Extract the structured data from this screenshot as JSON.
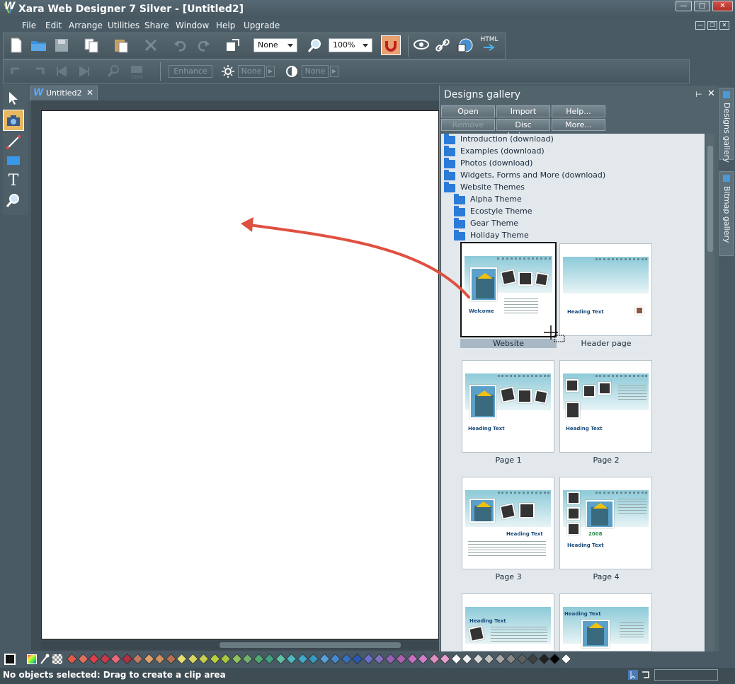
{
  "window": {
    "title": "Xara Web Designer 7 Silver - [Untitled2]"
  },
  "menu": {
    "items": [
      "File",
      "Edit",
      "Arrange",
      "Utilities",
      "Share",
      "Window",
      "Help",
      "Upgrade"
    ]
  },
  "toolbar": {
    "zoom_mode": "None",
    "zoom_percent": "100%",
    "html_label": "HTML"
  },
  "photo_toolbar": {
    "enhance_label": "Enhance",
    "brightness_value": "None",
    "contrast_value": "None"
  },
  "document_tab": {
    "label": "Untitled2"
  },
  "gallery": {
    "title": "Designs gallery",
    "buttons": {
      "open": "Open",
      "import": "Import",
      "help": "Help...",
      "remove": "Remove",
      "disc": "Disc designs...",
      "more": "More..."
    },
    "folders": [
      "Introduction (download)",
      "Examples (download)",
      "Photos (download)",
      "Widgets, Forms and More (download)",
      "Website Themes",
      "Alpha Theme",
      "Ecostyle Theme",
      "Gear Theme",
      "Holiday Theme"
    ],
    "thumbnails": [
      "Website",
      "Header page",
      "Page 1",
      "Page 2",
      "Page 3",
      "Page 4",
      "",
      ""
    ],
    "thumb_text": {
      "welcome": "Welcome",
      "heading": "Heading Text",
      "year": "2008"
    },
    "selected_item": "Website"
  },
  "side_tabs": [
    "Designs gallery",
    "Bitmap gallery"
  ],
  "status": {
    "text": "No objects selected: Drag to create a clip area"
  },
  "colors": {
    "accent_arrow": "#e05040",
    "folder_blue": "#2b7bd8",
    "palette": [
      "#e05a4a",
      "#e2705e",
      "#d8404a",
      "#c83848",
      "#e86878",
      "#b03040",
      "#c07a60",
      "#e0a070",
      "#d09060",
      "#b87050",
      "#e8e070",
      "#d8d860",
      "#c8d050",
      "#b8d040",
      "#a8c840",
      "#90c060",
      "#70b070",
      "#50a870",
      "#40a080",
      "#60c0a0",
      "#50b8c0",
      "#40a8c8",
      "#3898c0",
      "#58a0d8",
      "#4888d0",
      "#3870c0",
      "#2858b0",
      "#6870c8",
      "#8070c0",
      "#9860b8",
      "#b060b0",
      "#c870c0",
      "#d080c8",
      "#e090c0",
      "#e8a0d0",
      "#ffffff",
      "#f0f0f0",
      "#d8d8d8",
      "#c0c0c0",
      "#a8a8a8",
      "#888888",
      "#606060",
      "#404040",
      "#202020",
      "#000000",
      "#ffffff"
    ]
  }
}
